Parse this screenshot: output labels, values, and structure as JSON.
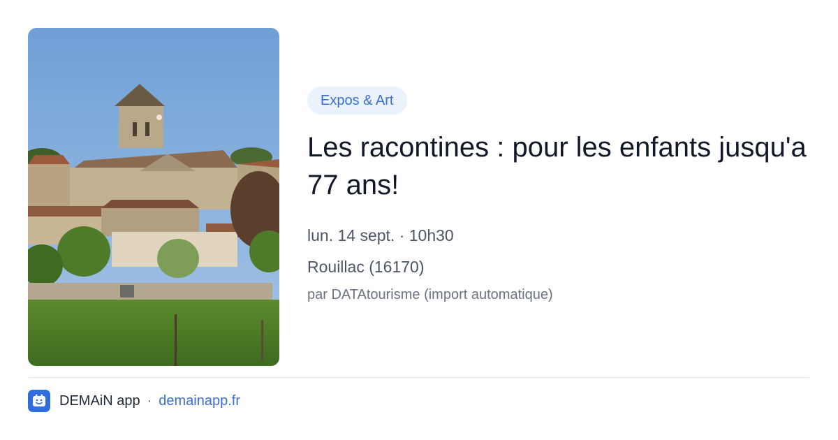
{
  "event": {
    "category": "Expos & Art",
    "title": "Les racontines : pour les enfants jusqu'a 77 ans!",
    "datetime": "lun. 14 sept. · 10h30",
    "location": "Rouillac (16170)",
    "source": "par DATAtourisme (import automatique)"
  },
  "footer": {
    "app_name": "DEMAiN app",
    "separator": "·",
    "url": "demainapp.fr",
    "logo_icon": "calendar-smile-icon"
  },
  "colors": {
    "accent": "#3a6fd0",
    "badge_bg": "#eaf2fd",
    "title": "#111827",
    "meta": "#4b5563",
    "divider": "#dfe7ee",
    "logo_bg": "#2f6ee0"
  }
}
